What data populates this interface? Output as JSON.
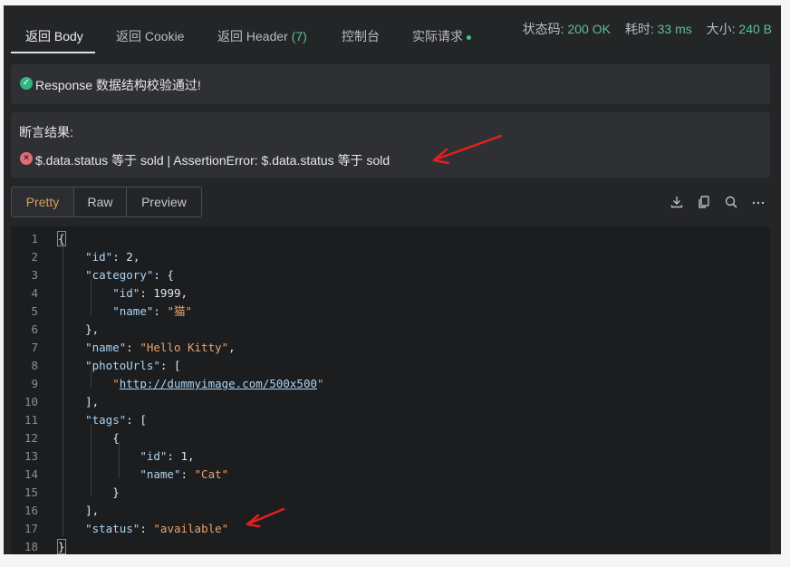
{
  "tabs": [
    {
      "label": "返回 Body"
    },
    {
      "label": "返回 Cookie"
    },
    {
      "label": "返回 Header",
      "count": "(7)"
    },
    {
      "label": "控制台"
    },
    {
      "label": "实际请求"
    }
  ],
  "metrics": {
    "status_label": "状态码:",
    "status_value": "200 OK",
    "time_label": "耗时:",
    "time_value": "33 ms",
    "size_label": "大小:",
    "size_value": "240 B"
  },
  "schema_check": {
    "message": "Response 数据结构校验通过!"
  },
  "assertion": {
    "title": "断言结果:",
    "message": "$.data.status 等于 sold | AssertionError: $.data.status 等于 sold"
  },
  "view_modes": [
    {
      "label": "Pretty",
      "active": true
    },
    {
      "label": "Raw",
      "active": false
    },
    {
      "label": "Preview",
      "active": false
    }
  ],
  "toolbar_icons": [
    "download-icon",
    "copy-icon",
    "search-icon",
    "more-icon"
  ],
  "code": {
    "line_numbers": [
      "1",
      "2",
      "3",
      "4",
      "5",
      "6",
      "7",
      "8",
      "9",
      "10",
      "11",
      "12",
      "13",
      "14",
      "15",
      "16",
      "17",
      "18"
    ],
    "id_key": "\"id\"",
    "id_val": "2",
    "category_key": "\"category\"",
    "cat_id_key": "\"id\"",
    "cat_id_val": "1999",
    "cat_name_key": "\"name\"",
    "cat_name_val": "\"猫\"",
    "name_key": "\"name\"",
    "name_val": "\"Hello Kitty\"",
    "photo_key": "\"photoUrls\"",
    "photo_url": "http://dummyimage.com/500x500",
    "tags_key": "\"tags\"",
    "tag_id_key": "\"id\"",
    "tag_id_val": "1",
    "tag_name_key": "\"name\"",
    "tag_name_val": "\"Cat\"",
    "status_key": "\"status\"",
    "status_val": "\"available\""
  },
  "colors": {
    "accent_green": "#5cc08f",
    "error_red": "#e06c75",
    "arrow_red": "#e02020",
    "active_tab": "#d6a25a"
  }
}
